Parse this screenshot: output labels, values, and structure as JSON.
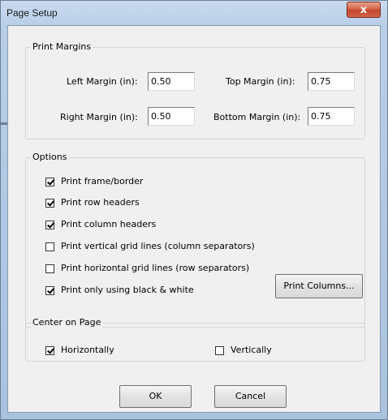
{
  "window": {
    "title": "Page Setup",
    "close_glyph": "x"
  },
  "print_margins": {
    "legend": "Print Margins",
    "left_label": "Left Margin (in):",
    "left_value": "0.50",
    "top_label": "Top Margin (in):",
    "top_value": "0.75",
    "right_label": "Right Margin (in):",
    "right_value": "0.50",
    "bottom_label": "Bottom Margin (in):",
    "bottom_value": "0.75"
  },
  "options": {
    "legend": "Options",
    "items": [
      {
        "label": "Print frame/border",
        "checked": true
      },
      {
        "label": "Print row headers",
        "checked": true
      },
      {
        "label": "Print column headers",
        "checked": true
      },
      {
        "label": "Print vertical grid lines (column separators)",
        "checked": false
      },
      {
        "label": "Print horizontal grid lines (row separators)",
        "checked": false
      },
      {
        "label": "Print only using black & white",
        "checked": true
      }
    ],
    "print_columns_label": "Print Columns..."
  },
  "center_on_page": {
    "legend": "Center on Page",
    "horizontally_label": "Horizontally",
    "horizontally_checked": true,
    "vertically_label": "Vertically",
    "vertically_checked": false
  },
  "buttons": {
    "ok_label": "OK",
    "cancel_label": "Cancel"
  }
}
